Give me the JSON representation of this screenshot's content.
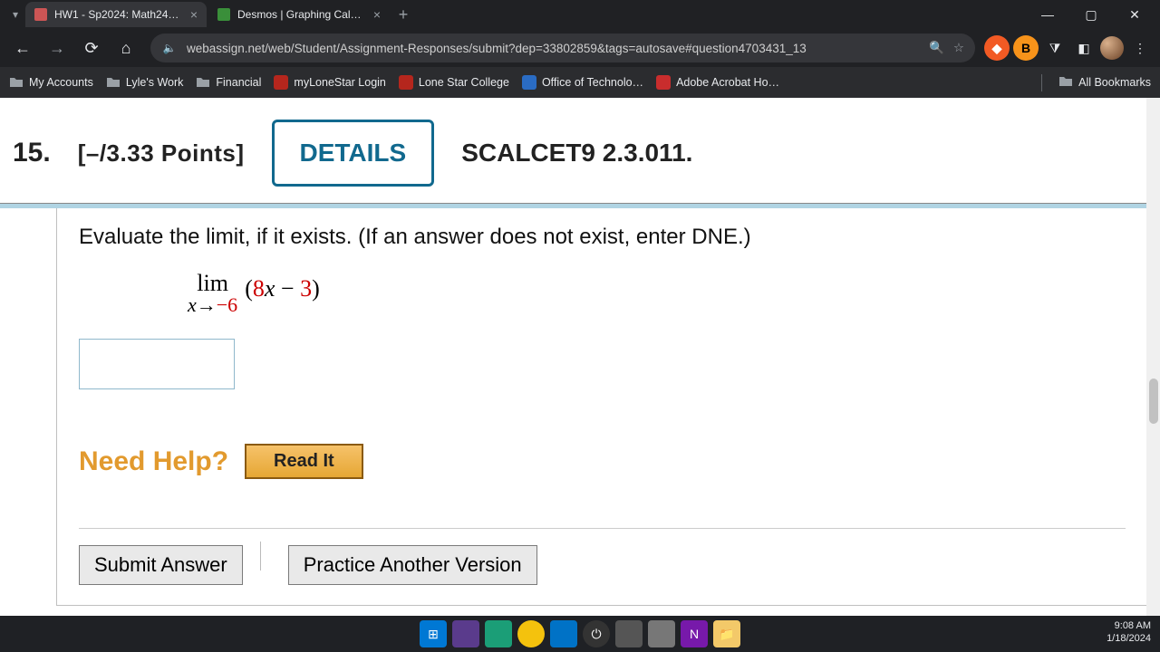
{
  "browser": {
    "tabs": [
      {
        "title": "HW1 - Sp2024: Math2413-2…",
        "active": true
      },
      {
        "title": "Desmos | Graphing Calculat…",
        "active": false
      }
    ],
    "url": "webassign.net/web/Student/Assignment-Responses/submit?dep=33802859&tags=autosave#question4703431_13",
    "bookmarks": [
      {
        "label": "My Accounts",
        "type": "folder"
      },
      {
        "label": "Lyle's Work",
        "type": "folder"
      },
      {
        "label": "Financial",
        "type": "folder"
      },
      {
        "label": "myLoneStar Login",
        "type": "link",
        "icon_color": "#b5261d"
      },
      {
        "label": "Lone Star College",
        "type": "link",
        "icon_color": "#b5261d"
      },
      {
        "label": "Office of Technolo…",
        "type": "link",
        "icon_color": "#2a6cc4"
      },
      {
        "label": "Adobe Acrobat Ho…",
        "type": "link",
        "icon_color": "#c92d2d"
      }
    ],
    "all_bookmarks_label": "All Bookmarks"
  },
  "question": {
    "number": "15.",
    "points": "[–/3.33 Points]",
    "details_label": "DETAILS",
    "source": "SCALCET9 2.3.011.",
    "prompt": "Evaluate the limit, if it exists. (If an answer does not exist, enter DNE.)",
    "limit": {
      "label": "lim",
      "approach_var": "x",
      "approach_arrow": "→",
      "approach_value": "−6",
      "expr_open": "(",
      "expr_num1": "8",
      "expr_var": "x",
      "expr_op": " − ",
      "expr_num2": "3",
      "expr_close": ")"
    },
    "answer_value": "",
    "need_help_label": "Need Help?",
    "read_it_label": "Read It",
    "submit_label": "Submit Answer",
    "practice_label": "Practice Another Version"
  },
  "system": {
    "time": "9:08 AM",
    "date": "1/18/2024"
  }
}
